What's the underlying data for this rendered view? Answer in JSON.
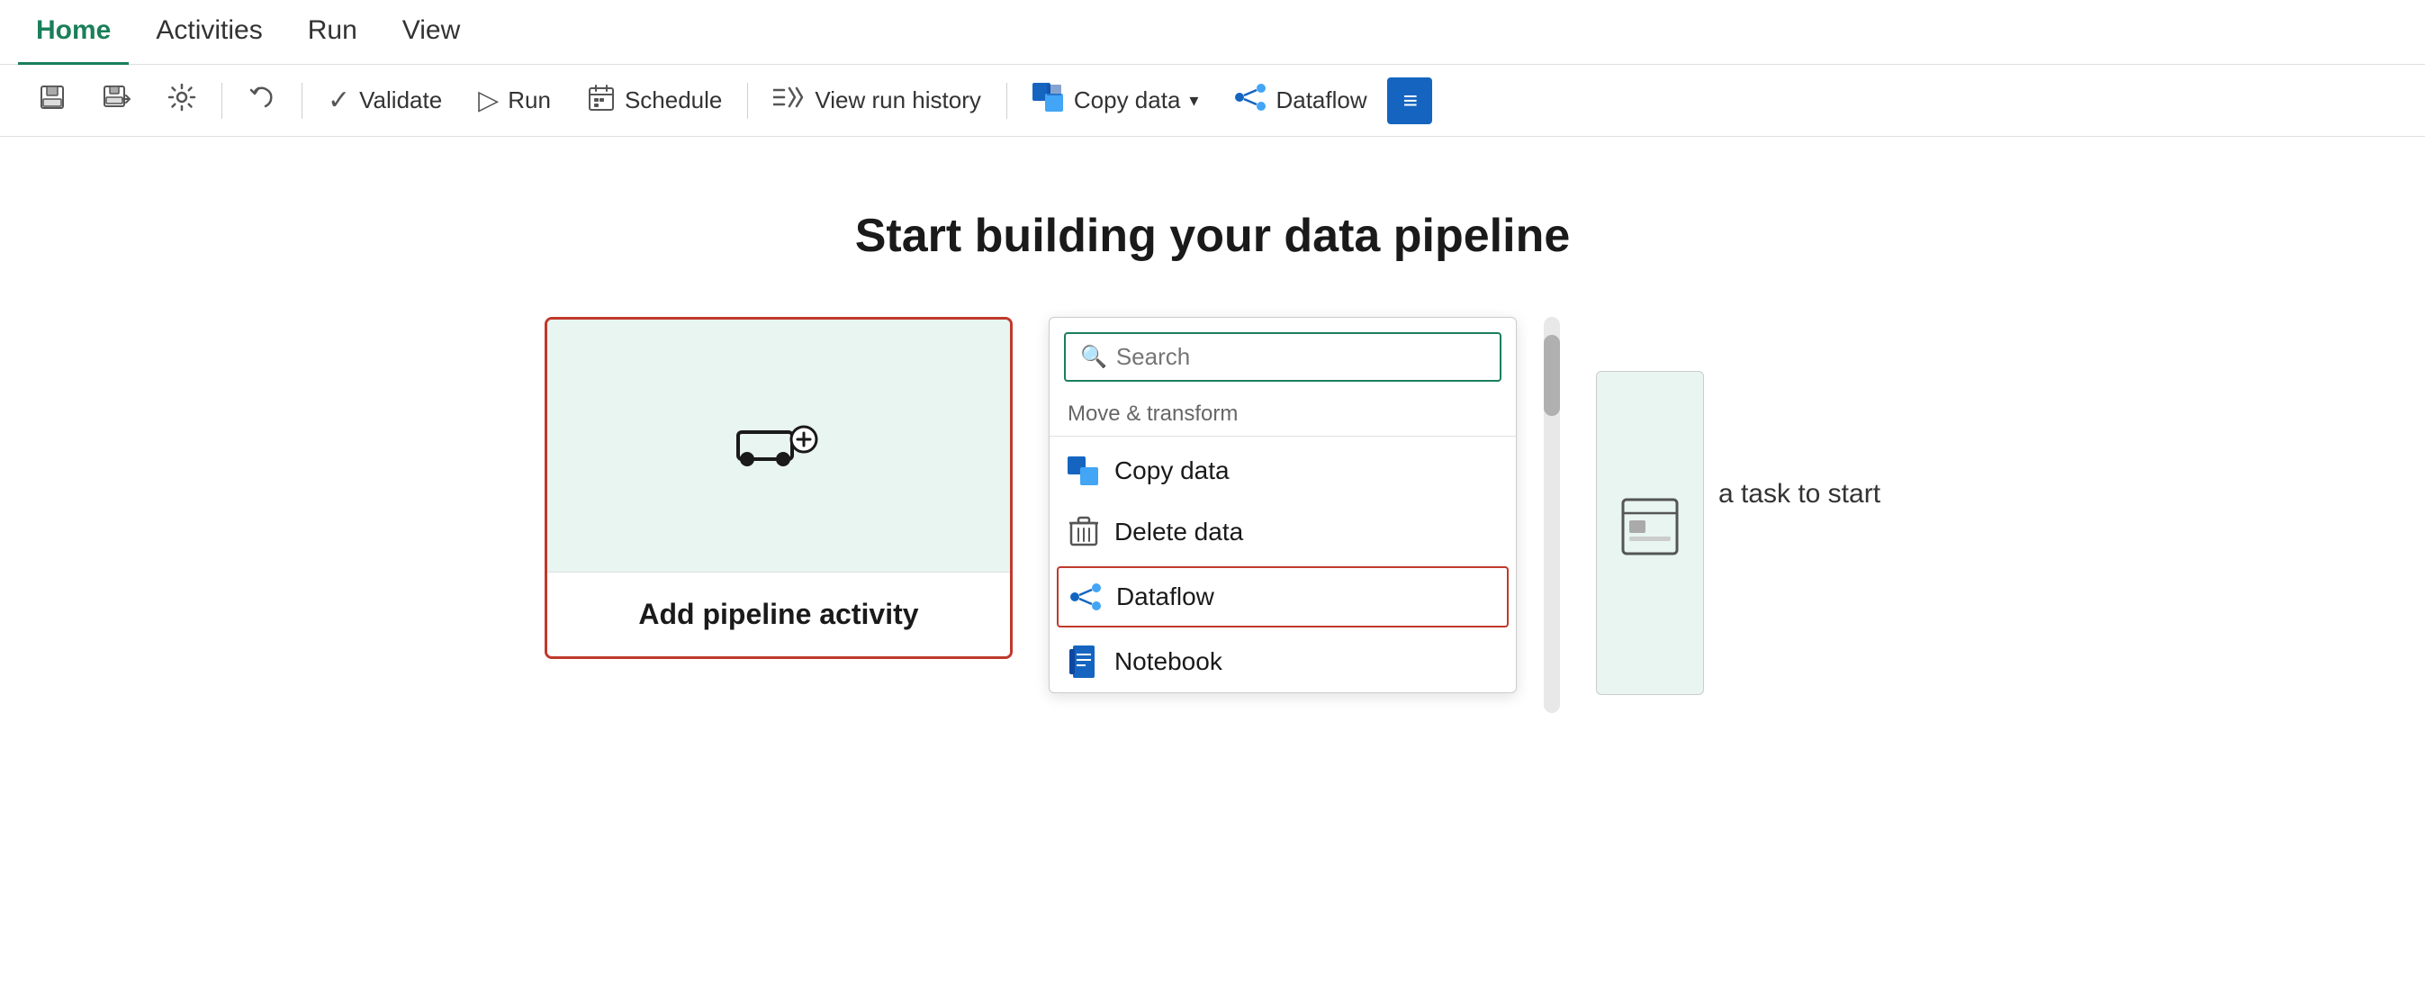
{
  "nav": {
    "tabs": [
      {
        "label": "Home",
        "active": true
      },
      {
        "label": "Activities",
        "active": false
      },
      {
        "label": "Run",
        "active": false
      },
      {
        "label": "View",
        "active": false
      }
    ]
  },
  "toolbar": {
    "save_icon": "💾",
    "save_label": "",
    "save_as_label": "",
    "settings_label": "",
    "undo_label": "",
    "validate_label": "Validate",
    "run_label": "Run",
    "schedule_label": "Schedule",
    "view_run_history_label": "View run history",
    "copy_data_label": "Copy data",
    "dataflow_label": "Dataflow"
  },
  "main": {
    "page_title": "Start building your data pipeline",
    "activity_card": {
      "label": "Add pipeline activity"
    },
    "search": {
      "placeholder": "Search"
    },
    "section": {
      "label": "Move & transform"
    },
    "menu_items": [
      {
        "id": "copy-data",
        "label": "Copy data",
        "icon_type": "copy-data"
      },
      {
        "id": "delete-data",
        "label": "Delete data",
        "icon_type": "delete-data"
      },
      {
        "id": "dataflow",
        "label": "Dataflow",
        "icon_type": "dataflow",
        "selected": true
      },
      {
        "id": "notebook",
        "label": "Notebook",
        "icon_type": "notebook"
      }
    ],
    "right_hint": "a task to start"
  }
}
